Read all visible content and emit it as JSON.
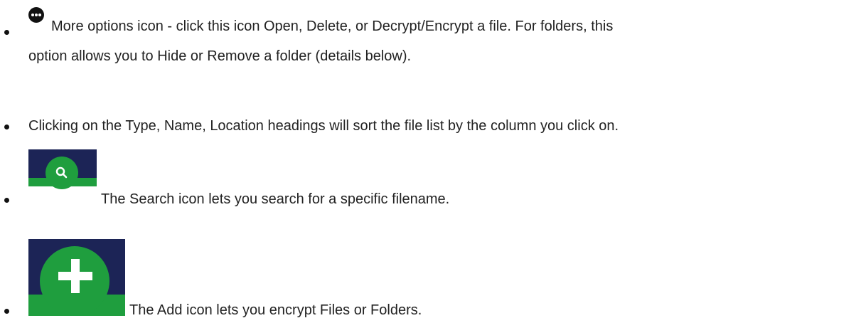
{
  "items": [
    {
      "icon": "more-options-icon",
      "line1": "More options icon -  click this icon Open, Delete, or Decrypt/Encrypt a file.  For folders, this",
      "line2": "option allows you to Hide or Remove a folder (details below)."
    },
    {
      "text": "Clicking on the Type, Name, Location headings will sort the file list by the column you click on."
    },
    {
      "icon": "search-icon",
      "text": "The Search icon lets you search for a specific filename."
    },
    {
      "icon": "add-icon",
      "text": "The Add icon lets you encrypt Files or Folders."
    }
  ],
  "colors": {
    "icon_background": "#1c2456",
    "icon_green": "#1f9e3e",
    "text": "#222222"
  }
}
